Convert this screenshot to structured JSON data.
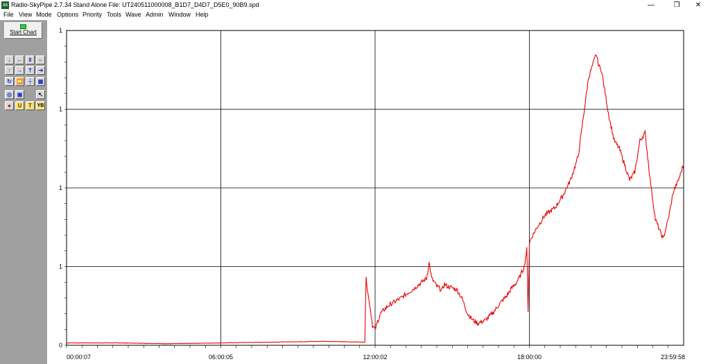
{
  "window": {
    "icon_text": "SA",
    "title": "Radio-SkyPipe  2.7.34  Stand Alone  File: UT240511000008_B1D7_D4D7_D5E0_90B9.spd",
    "minimize": "—",
    "restore": "❐",
    "close": "✕"
  },
  "menu": [
    "File",
    "View",
    "Mode",
    "Options",
    "Priority",
    "Tools",
    "Wave",
    "Admin",
    "Window",
    "Help"
  ],
  "sidebar": {
    "start_button": "Start Chart",
    "tools": [
      {
        "name": "scroll-down-icon",
        "glyph": "↓"
      },
      {
        "name": "scroll-left-icon",
        "glyph": "←"
      },
      {
        "name": "expand-vertical-icon",
        "glyph": "⇕"
      },
      {
        "name": "expand-horizontal-icon",
        "glyph": "⇔"
      },
      {
        "name": "scroll-up-icon",
        "glyph": "↑"
      },
      {
        "name": "scroll-right-icon",
        "glyph": "→"
      },
      {
        "name": "compress-vertical-icon",
        "glyph": "⤒"
      },
      {
        "name": "compress-horizontal-icon",
        "glyph": "⇥"
      },
      {
        "name": "refresh-icon",
        "glyph": "↻"
      },
      {
        "name": "fast-forward-icon",
        "glyph": "⏩"
      },
      {
        "name": "crosshair-icon",
        "glyph": "┼"
      },
      {
        "name": "grid-icon",
        "glyph": "▦"
      },
      {
        "name": "zoom-fit-icon",
        "glyph": "◎"
      },
      {
        "name": "zoom-box-icon",
        "glyph": "▣"
      },
      {
        "name": "cursor-icon",
        "glyph": "↖"
      },
      {
        "name": "record-icon",
        "glyph": "●"
      },
      {
        "name": "marker-u-icon",
        "glyph": "U"
      },
      {
        "name": "marker-t-icon",
        "glyph": "T"
      },
      {
        "name": "y-bounds-icon",
        "glyph": "YB"
      }
    ]
  },
  "chart_data": {
    "type": "line",
    "title": "",
    "xlabel": "",
    "ylabel": "",
    "y_tick_labels": [
      "0",
      "1",
      "1",
      "1",
      "1",
      "1"
    ],
    "x_tick_labels": [
      "00:00:07",
      "06:00:05",
      "12:00:02",
      "18:00:00",
      "23:59:58"
    ],
    "xlim_hours": [
      0.0,
      24.0
    ],
    "ylim": [
      0,
      4
    ],
    "grid": true,
    "series": [
      {
        "color": "#e60000",
        "x_hours": [
          0.0,
          2.0,
          4.0,
          6.0,
          8.0,
          10.0,
          11.6,
          11.65,
          11.7,
          11.8,
          11.9,
          12.0,
          12.05,
          12.2,
          12.5,
          13.0,
          13.5,
          14.0,
          14.1,
          14.2,
          14.4,
          14.6,
          14.7,
          14.8,
          15.0,
          15.2,
          15.4,
          15.6,
          15.8,
          16.0,
          16.3,
          16.6,
          16.9,
          17.1,
          17.3,
          17.5,
          17.6,
          17.8,
          17.9,
          17.95,
          18.0,
          18.1,
          18.3,
          18.6,
          19.0,
          19.3,
          19.6,
          19.9,
          20.1,
          20.3,
          20.5,
          20.6,
          20.7,
          20.8,
          20.9,
          21.1,
          21.3,
          21.5,
          21.7,
          21.9,
          22.1,
          22.3,
          22.5,
          22.7,
          22.9,
          23.2,
          23.4,
          23.6,
          23.8,
          24.0
        ],
        "y": [
          0.03,
          0.03,
          0.02,
          0.03,
          0.04,
          0.05,
          0.04,
          0.9,
          0.7,
          0.5,
          0.25,
          0.2,
          0.25,
          0.4,
          0.5,
          0.6,
          0.72,
          0.85,
          1.05,
          0.85,
          0.75,
          0.7,
          0.78,
          0.75,
          0.73,
          0.7,
          0.58,
          0.4,
          0.32,
          0.28,
          0.32,
          0.42,
          0.55,
          0.62,
          0.72,
          0.8,
          0.85,
          1.0,
          1.22,
          0.45,
          1.3,
          1.38,
          1.5,
          1.65,
          1.75,
          1.9,
          2.1,
          2.4,
          2.9,
          3.4,
          3.6,
          3.7,
          3.55,
          3.5,
          3.3,
          2.9,
          2.6,
          2.5,
          2.3,
          2.1,
          2.2,
          2.6,
          2.7,
          2.1,
          1.6,
          1.35,
          1.6,
          1.95,
          2.1,
          2.3
        ]
      }
    ]
  }
}
